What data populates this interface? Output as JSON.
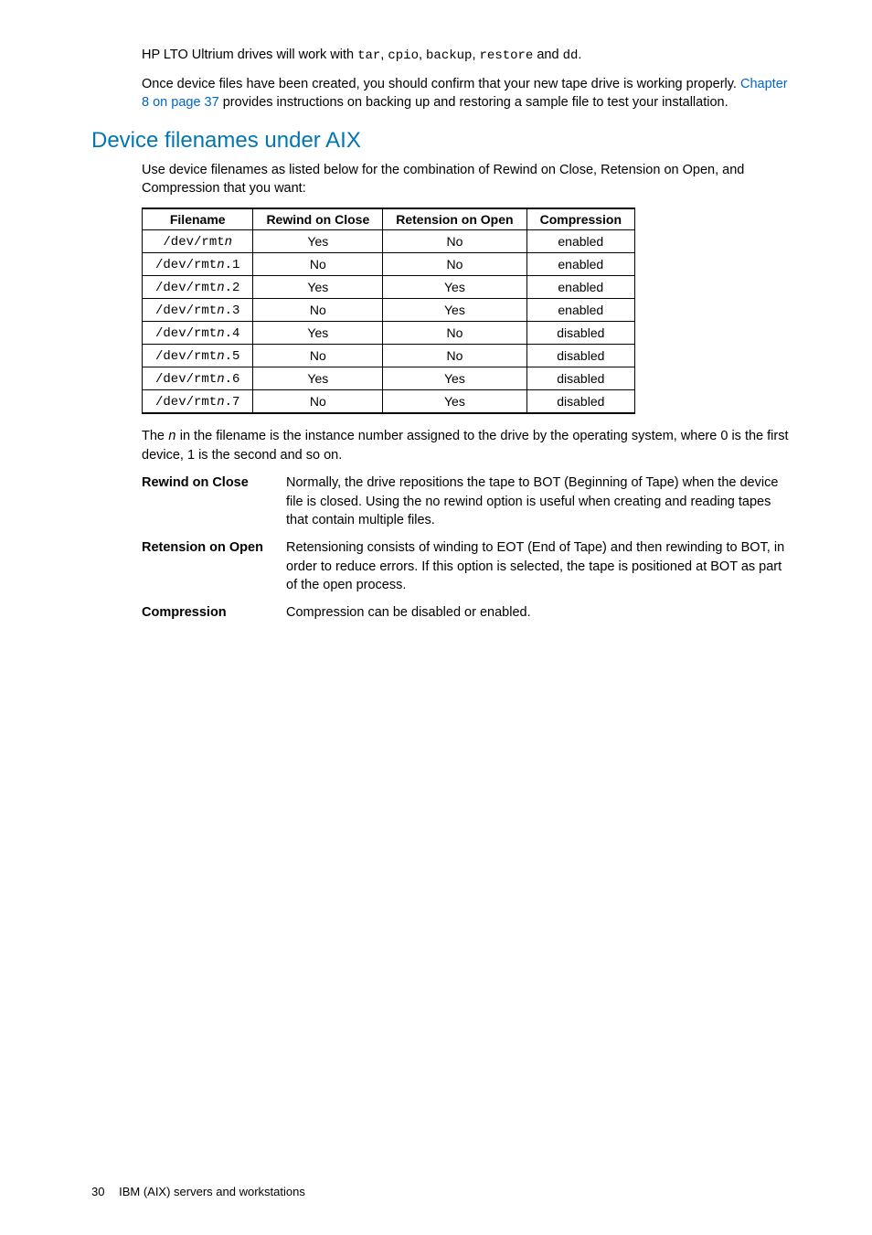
{
  "intro": {
    "p1_a": "HP LTO Ultrium drives will work with ",
    "p1_codes": [
      "tar",
      "cpio",
      "backup",
      "restore",
      "dd"
    ],
    "p1_sep": ", ",
    "p1_and": " and ",
    "p1_end": ".",
    "p2_a": "Once device files have been created, you should confirm that your new tape drive is working properly. ",
    "p2_link": "Chapter 8 on page 37",
    "p2_b": " provides instructions on backing up and restoring a sample file to test your installation."
  },
  "section_title": "Device filenames under AIX",
  "section_intro": "Use device filenames as listed below for the combination of Rewind on Close, Retension on Open, and Compression that you want:",
  "table": {
    "headers": [
      "Filename",
      "Rewind on Close",
      "Retension on Open",
      "Compression"
    ],
    "rows": [
      {
        "f": "/dev/rmt",
        "n": "n",
        "s": "",
        "r": "Yes",
        "t": "No",
        "c": "enabled"
      },
      {
        "f": "/dev/rmt",
        "n": "n",
        "s": ".1",
        "r": "No",
        "t": "No",
        "c": "enabled"
      },
      {
        "f": "/dev/rmt",
        "n": "n",
        "s": ".2",
        "r": "Yes",
        "t": "Yes",
        "c": "enabled"
      },
      {
        "f": "/dev/rmt",
        "n": "n",
        "s": ".3",
        "r": "No",
        "t": "Yes",
        "c": "enabled"
      },
      {
        "f": "/dev/rmt",
        "n": "n",
        "s": ".4",
        "r": "Yes",
        "t": "No",
        "c": "disabled"
      },
      {
        "f": "/dev/rmt",
        "n": "n",
        "s": ".5",
        "r": "No",
        "t": "No",
        "c": "disabled"
      },
      {
        "f": "/dev/rmt",
        "n": "n",
        "s": ".6",
        "r": "Yes",
        "t": "Yes",
        "c": "disabled"
      },
      {
        "f": "/dev/rmt",
        "n": "n",
        "s": ".7",
        "r": "No",
        "t": "Yes",
        "c": "disabled"
      }
    ]
  },
  "note": {
    "a": "The ",
    "n": "n",
    "b": " in the filename is the instance number assigned to the drive by the operating system, where 0 is the first device, 1 is the second and so on."
  },
  "defs": [
    {
      "term": "Rewind on Close",
      "desc": "Normally, the drive repositions the tape to BOT (Beginning of Tape) when the device file is closed. Using the no rewind option is useful when creating and reading tapes that contain multiple files."
    },
    {
      "term": "Retension on Open",
      "desc": "Retensioning consists of winding to EOT (End of Tape) and then rewinding to BOT, in order to reduce errors. If this option is selected, the tape is positioned at BOT as part of the open process."
    },
    {
      "term": "Compression",
      "desc": "Compression can be disabled or enabled."
    }
  ],
  "footer": {
    "page": "30",
    "title": "IBM (AIX) servers and workstations"
  }
}
